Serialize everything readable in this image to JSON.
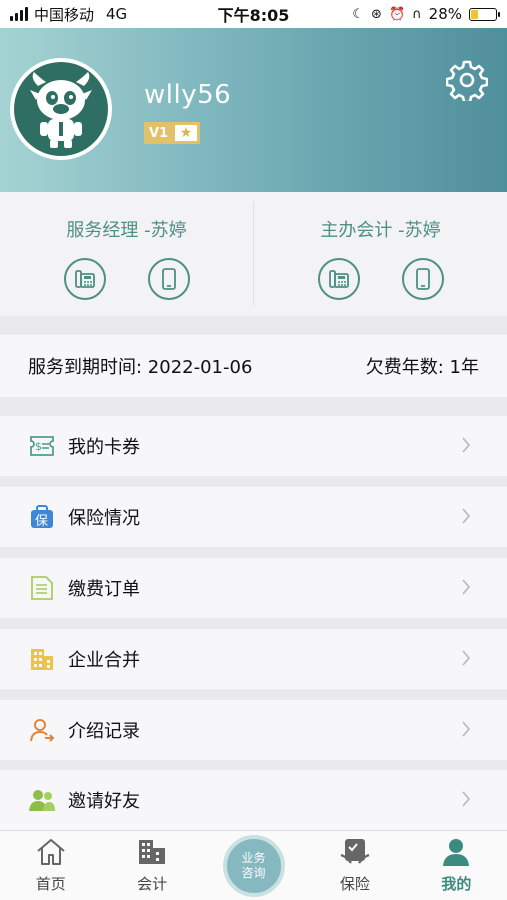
{
  "status_bar": {
    "carrier": "中国移动",
    "network": "4G",
    "time": "下午8:05",
    "battery": "28%",
    "battery_level": 0.28
  },
  "profile": {
    "username": "wlly56",
    "level": "V1"
  },
  "contacts": [
    {
      "title": "服务经理 -苏婷"
    },
    {
      "title": "主办会计 -苏婷"
    }
  ],
  "service": {
    "expiry_text": "服务到期时间: 2022-01-06",
    "arrears_text": "欠费年数: 1年"
  },
  "menu": [
    {
      "label": "我的卡券",
      "icon": "coupon-icon"
    },
    {
      "label": "保险情况",
      "icon": "insurance-icon"
    },
    {
      "label": "缴费订单",
      "icon": "order-icon"
    },
    {
      "label": "企业合并",
      "icon": "building-icon"
    },
    {
      "label": "介绍记录",
      "icon": "referral-icon"
    },
    {
      "label": "邀请好友",
      "icon": "friends-icon"
    }
  ],
  "tabs": {
    "home": "首页",
    "accounting": "会计",
    "consult_line1": "业务",
    "consult_line2": "咨询",
    "insurance": "保险",
    "mine": "我的"
  },
  "colors": {
    "accent": "#3d8b80",
    "header_start": "#a5d3d3",
    "header_end": "#4f8f9b",
    "badge": "#e1c16a"
  }
}
